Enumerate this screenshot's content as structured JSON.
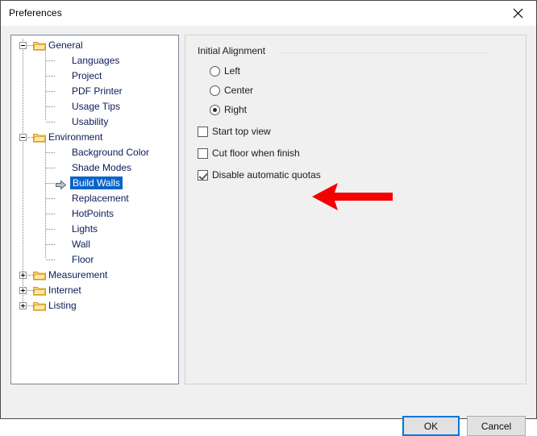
{
  "window": {
    "title": "Preferences",
    "close_icon": "close-icon"
  },
  "tree": {
    "nodes": [
      {
        "label": "General",
        "level": 0,
        "expander": "minus",
        "icon": "folder-icon",
        "selected": false
      },
      {
        "label": "Languages",
        "level": 1,
        "expander": "none",
        "icon": "none",
        "selected": false
      },
      {
        "label": "Project",
        "level": 1,
        "expander": "none",
        "icon": "none",
        "selected": false
      },
      {
        "label": "PDF Printer",
        "level": 1,
        "expander": "none",
        "icon": "none",
        "selected": false
      },
      {
        "label": "Usage Tips",
        "level": 1,
        "expander": "none",
        "icon": "none",
        "selected": false
      },
      {
        "label": "Usability",
        "level": 1,
        "expander": "none",
        "icon": "none",
        "selected": false
      },
      {
        "label": "Environment",
        "level": 0,
        "expander": "minus",
        "icon": "folder-icon",
        "selected": false
      },
      {
        "label": "Background Color",
        "level": 1,
        "expander": "none",
        "icon": "none",
        "selected": false
      },
      {
        "label": "Shade Modes",
        "level": 1,
        "expander": "none",
        "icon": "none",
        "selected": false
      },
      {
        "label": "Build Walls",
        "level": 1,
        "expander": "none",
        "icon": "right-arrow-cursor-icon",
        "selected": true
      },
      {
        "label": "Replacement",
        "level": 1,
        "expander": "none",
        "icon": "none",
        "selected": false
      },
      {
        "label": "HotPoints",
        "level": 1,
        "expander": "none",
        "icon": "none",
        "selected": false
      },
      {
        "label": "Lights",
        "level": 1,
        "expander": "none",
        "icon": "none",
        "selected": false
      },
      {
        "label": "Wall",
        "level": 1,
        "expander": "none",
        "icon": "none",
        "selected": false
      },
      {
        "label": "Floor",
        "level": 1,
        "expander": "none",
        "icon": "none",
        "selected": false
      },
      {
        "label": "Measurement",
        "level": 0,
        "expander": "plus",
        "icon": "folder-icon",
        "selected": false
      },
      {
        "label": "Internet",
        "level": 0,
        "expander": "plus",
        "icon": "folder-icon",
        "selected": false
      },
      {
        "label": "Listing",
        "level": 0,
        "expander": "plus",
        "icon": "folder-icon",
        "selected": false
      }
    ],
    "selection_color": "#0a64c8",
    "text_color": "#0c1b5a"
  },
  "settings": {
    "group_label": "Initial Alignment",
    "radios": [
      {
        "label": "Left",
        "checked": false
      },
      {
        "label": "Center",
        "checked": false
      },
      {
        "label": "Right",
        "checked": true
      }
    ],
    "checkboxes": [
      {
        "label": "Start top view",
        "checked": false
      },
      {
        "label": "Cut floor when finish",
        "checked": false
      },
      {
        "label": "Disable automatic quotas",
        "checked": true
      }
    ]
  },
  "annotation": {
    "arrow_icon": "left-arrow-annotation-icon",
    "arrow_color": "#f40000"
  },
  "buttons": {
    "ok": "OK",
    "cancel": "Cancel",
    "default_focus_color": "#0078d7"
  }
}
